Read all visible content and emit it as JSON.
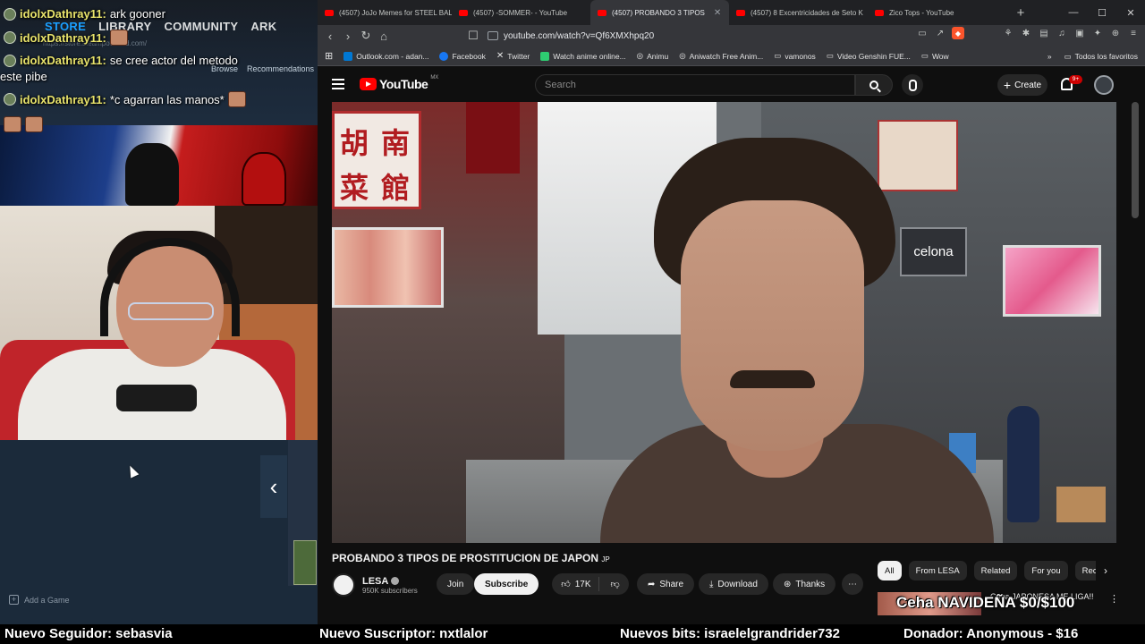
{
  "chat": {
    "lines": [
      {
        "user": "idolxDathray11:",
        "msg": "ark gooner"
      },
      {
        "user": "idolxDathray11:",
        "msg": ""
      },
      {
        "user": "idolxDathray11:",
        "msg": "se cree actor del metodo"
      },
      {
        "user": "",
        "msg": "este pibe"
      },
      {
        "user": "idolxDathray11:",
        "msg": "*c agarran las manos*"
      }
    ]
  },
  "steam": {
    "nav": [
      "STORE",
      "LIBRARY",
      "COMMUNITY",
      "ARK"
    ],
    "url": "https://store.steampowered.com/",
    "subnav": [
      "Browse",
      "Recommendations"
    ],
    "add_game": "Add a Game"
  },
  "browser": {
    "tabs": [
      {
        "label": "(4507) JoJo Memes for STEEL BALL",
        "active": false
      },
      {
        "label": "(4507) -SOMMER- - YouTube",
        "active": false
      },
      {
        "label": "(4507) PROBANDO 3 TIPOS",
        "active": true
      },
      {
        "label": "(4507) 8 Excentricidades de Seto K",
        "active": false
      },
      {
        "label": "Zico Tops - YouTube",
        "active": false
      }
    ],
    "url": "youtube.com/watch?v=Qf6XMXhpq20",
    "bookmarks": [
      {
        "label": "Outlook.com - adan...",
        "color": "#0078d4"
      },
      {
        "label": "Facebook",
        "color": "#1877f2"
      },
      {
        "label": "Twitter",
        "color": "#111111"
      },
      {
        "label": "Watch anime online...",
        "color": "#2ecc71"
      },
      {
        "label": "Animu",
        "color": "#888888"
      },
      {
        "label": "Aniwatch Free Anim...",
        "color": "#888888"
      },
      {
        "label": "vamonos",
        "color": "#c4c7c5"
      },
      {
        "label": "Video Genshin FUE...",
        "color": "#c4c7c5"
      },
      {
        "label": "Wow",
        "color": "#c4c7c5"
      }
    ],
    "bookmarks_overflow": "»",
    "all_bookmarks": "Todos los favoritos"
  },
  "youtube": {
    "logo": "YouTube",
    "country": "MX",
    "search_placeholder": "Search",
    "create_label": "Create",
    "notif_count": "9+",
    "video_title": "PROBANDO 3 TIPOS DE PROSTITUCION DE JAPON",
    "title_flag": "JP",
    "channel": "LESA",
    "subscribers": "950K subscribers",
    "join_label": "Join",
    "subscribe_label": "Subscribe",
    "likes": "17K",
    "share_label": "Share",
    "download_label": "Download",
    "thanks_label": "Thanks",
    "chips": [
      "All",
      "From LESA",
      "Related",
      "For you",
      "Rece"
    ],
    "rec_title": "Cena JAPONESA ME LIGA!!",
    "video_signs": {
      "celona": "celona",
      "kanji": [
        "胡",
        "南",
        "菜",
        "館"
      ]
    }
  },
  "overlay": {
    "navidena": "Ceha NAVIDEÑA $0/$100",
    "follower": "Nuevo Seguidor: sebasvia",
    "subscriber": "Nuevo Suscriptor: nxtlalor",
    "bits": "Nuevos bits: israelelgrandrider732",
    "donation": "Donador: Anonymous - $16"
  }
}
